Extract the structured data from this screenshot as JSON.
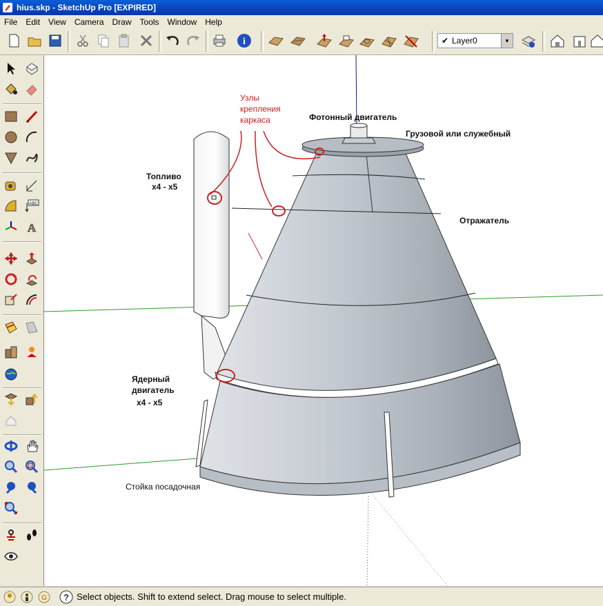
{
  "window": {
    "title": "hius.skp - SketchUp Pro [EXPIRED]"
  },
  "menu": [
    "File",
    "Edit",
    "View",
    "Camera",
    "Draw",
    "Tools",
    "Window",
    "Help"
  ],
  "toolbar": {
    "layer_value": "Layer0"
  },
  "status": {
    "text": "Select objects. Shift to extend select. Drag mouse to select multiple."
  },
  "annotations": {
    "nodes": [
      "Узлы",
      "крепления",
      "каркаса"
    ],
    "photon": "Фотонный двигатель",
    "cargo": "Грузовой или служебный",
    "fuel": [
      "Топливо",
      "x4 - x5"
    ],
    "reflector": "Отражатель",
    "nuclear": [
      "Ядерный",
      "двигатель",
      "x4 - x5"
    ],
    "landing": "Стойка посадочная"
  },
  "colors": {
    "accent_red": "#cc2020",
    "axis_green": "#2a9a2a",
    "axis_blue": "#1a1a80",
    "model_face": "#c9cfd6"
  }
}
